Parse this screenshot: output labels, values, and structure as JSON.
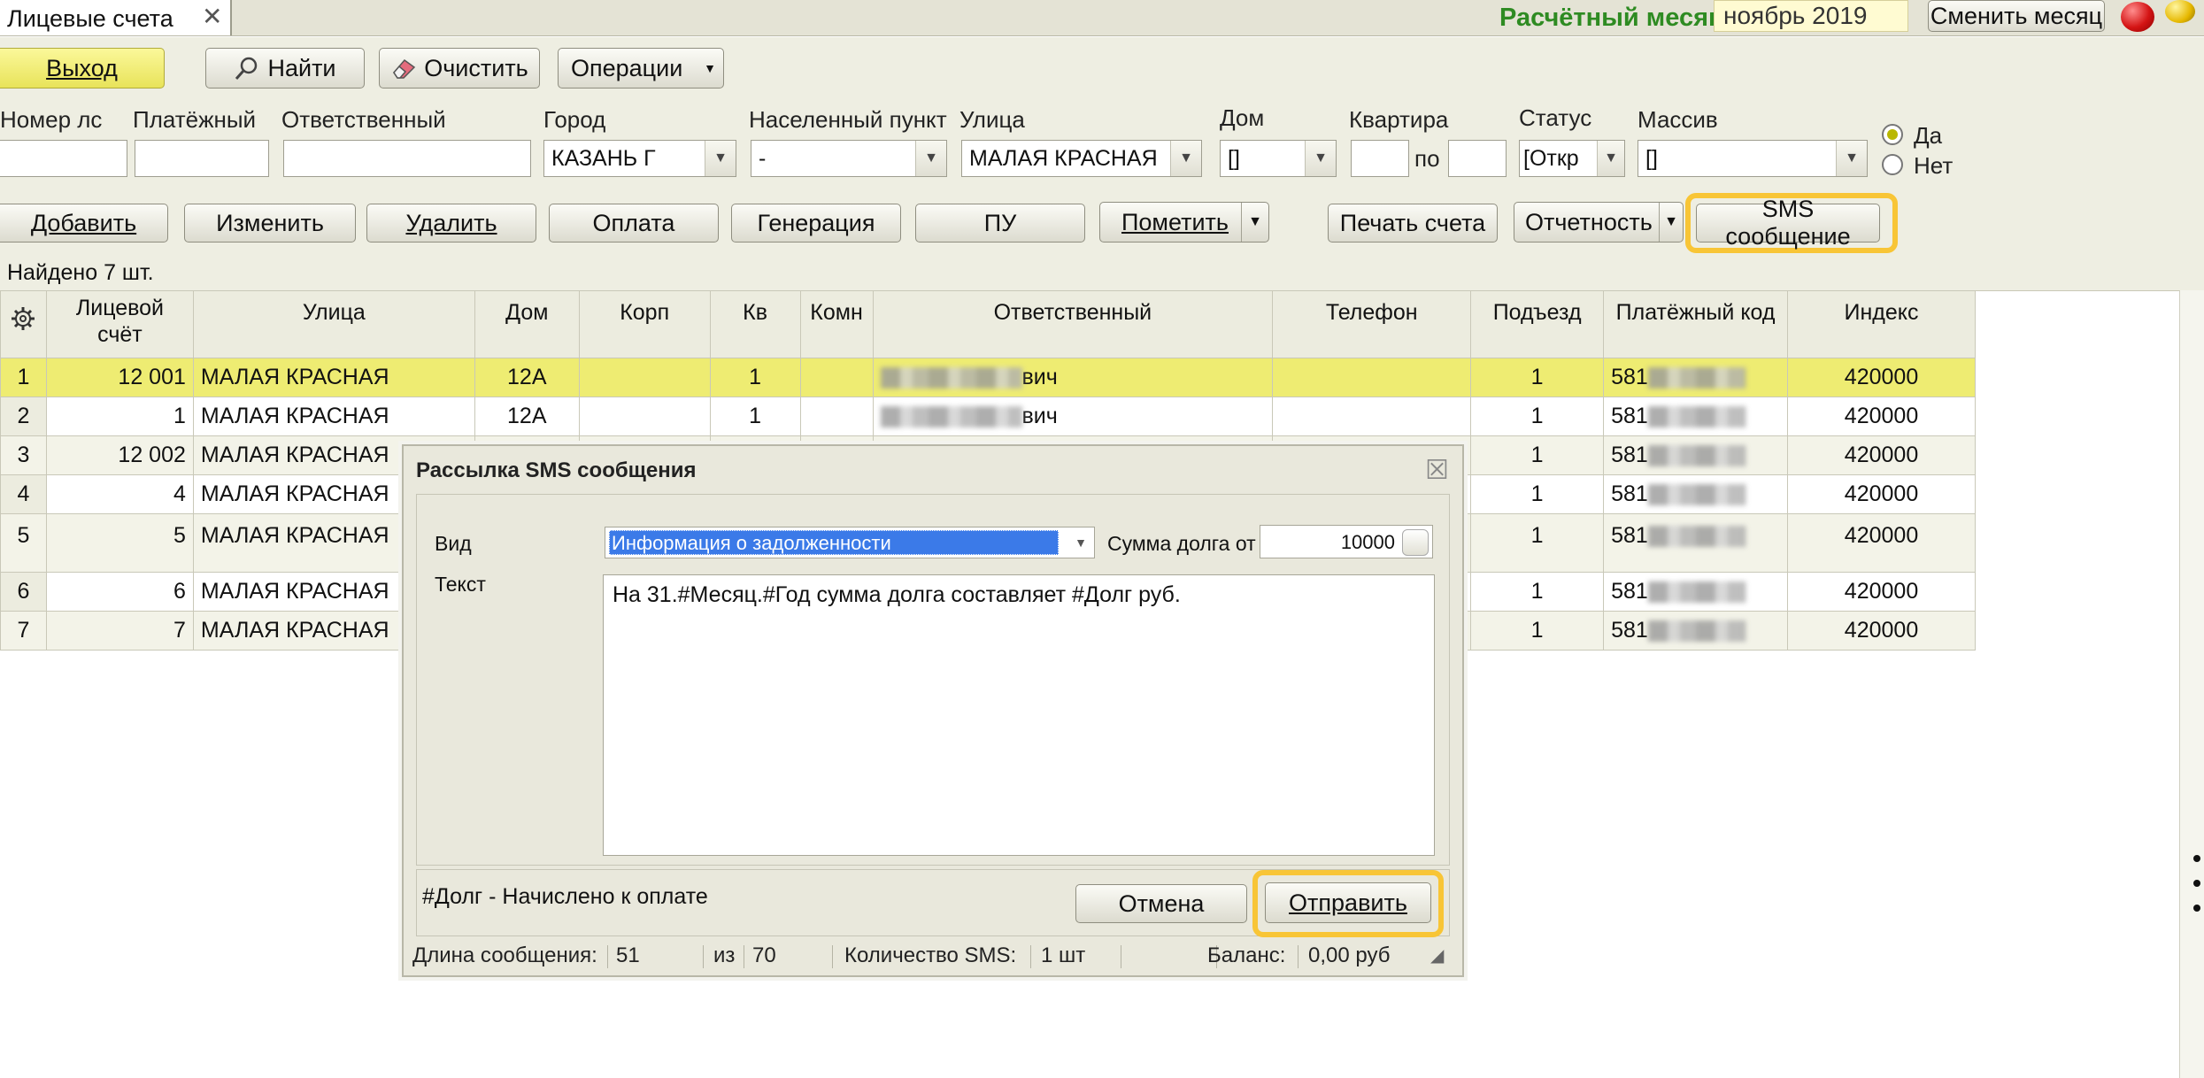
{
  "titlebar": {
    "tab_title": "Лицевые счета",
    "tab_close": "✕",
    "month_label": "Расчётный месяц",
    "month_value": "ноябрь 2019",
    "change_month": "Сменить месяц"
  },
  "toolbar": {
    "exit": "Выход",
    "find": "Найти",
    "clear": "Очистить",
    "operations": "Операции"
  },
  "filters": {
    "account_no": {
      "label": "Номер лс",
      "value": ""
    },
    "payer": {
      "label": "Платёжный",
      "value": ""
    },
    "responsible": {
      "label": "Ответственный",
      "value": ""
    },
    "city": {
      "label": "Город",
      "value": "КАЗАНЬ Г"
    },
    "settlement": {
      "label": "Населенный пункт",
      "value": "-"
    },
    "street": {
      "label": "Улица",
      "value": "МАЛАЯ КРАСНАЯ"
    },
    "house": {
      "label": "Дом",
      "value": "[]"
    },
    "apartment": {
      "label": "Квартира",
      "value": "",
      "to_label": "по",
      "to_value": ""
    },
    "status": {
      "label": "Статус",
      "value": "[Откр"
    },
    "array": {
      "label": "Массив",
      "value": "[]"
    },
    "radio_yes": "Да",
    "radio_no": "Нет",
    "radio_selected": "Да"
  },
  "actions": {
    "add": "Добавить",
    "edit": "Изменить",
    "delete": "Удалить",
    "payment": "Оплата",
    "generation": "Генерация",
    "pu": "ПУ",
    "mark": "Пометить",
    "print": "Печать счета",
    "reports": "Отчетность",
    "sms": "SMS сообщение",
    "highlight_color": "#f8c536"
  },
  "found_text": "Найдено 7 шт.",
  "grid": {
    "columns": [
      "Лицевой\nсчёт",
      "Улица",
      "Дом",
      "Корп",
      "Кв",
      "Комн",
      "Ответственный",
      "Телефон",
      "Подъезд",
      "Платёжный код",
      "Индекс"
    ],
    "rows": [
      {
        "n": "1",
        "account": "12 001",
        "street": "МАЛАЯ КРАСНАЯ",
        "house": "12А",
        "korp": "",
        "kv": "1",
        "komn": "",
        "resp_tail": "вич",
        "phone": "",
        "entrance": "1",
        "pay_prefix": "581",
        "index": "420000",
        "selected": true
      },
      {
        "n": "2",
        "account": "1",
        "street": "МАЛАЯ КРАСНАЯ",
        "house": "12А",
        "korp": "",
        "kv": "1",
        "komn": "",
        "resp_tail": "вич",
        "phone": "",
        "entrance": "1",
        "pay_prefix": "581",
        "index": "420000"
      },
      {
        "n": "3",
        "account": "12 002",
        "street": "МАЛАЯ КРАСНАЯ",
        "house": "",
        "korp": "",
        "kv": "",
        "komn": "",
        "resp_tail": "",
        "phone": "",
        "entrance": "1",
        "pay_prefix": "581",
        "index": "420000"
      },
      {
        "n": "4",
        "account": "4",
        "street": "МАЛАЯ КРАСНАЯ",
        "house": "",
        "korp": "",
        "kv": "",
        "komn": "",
        "resp_tail": "",
        "phone": "",
        "entrance": "1",
        "pay_prefix": "581",
        "index": "420000"
      },
      {
        "n": "5",
        "account": "5",
        "street": "МАЛАЯ КРАСНАЯ",
        "house": "",
        "korp": "",
        "kv": "",
        "komn": "",
        "resp_tail": "",
        "phone": "",
        "entrance": "1",
        "pay_prefix": "581",
        "index": "420000",
        "tall": true
      },
      {
        "n": "6",
        "account": "6",
        "street": "МАЛАЯ КРАСНАЯ",
        "house": "",
        "korp": "",
        "kv": "",
        "komn": "",
        "resp_tail": "",
        "phone": "",
        "entrance": "1",
        "pay_prefix": "581",
        "index": "420000"
      },
      {
        "n": "7",
        "account": "7",
        "street": "МАЛАЯ КРАСНАЯ",
        "house": "",
        "korp": "",
        "kv": "",
        "komn": "",
        "resp_tail": "",
        "phone": "",
        "entrance": "1",
        "pay_prefix": "581",
        "index": "420000"
      }
    ]
  },
  "dialog": {
    "title": "Рассылка SMS сообщения",
    "close": "☒",
    "type_label": "Вид",
    "type_value": "Информация о задолженности",
    "debt_label": "Сумма долга от",
    "debt_value": "10000",
    "text_label": "Текст",
    "text_value": "На 31.#Месяц.#Год сумма долга составляет #Долг руб.",
    "hint": "#Долг - Начислено к оплате",
    "cancel": "Отмена",
    "send": "Отправить",
    "status": {
      "length_label": "Длина сообщения:",
      "length_value": "51",
      "of_label": "из",
      "of_value": "70",
      "count_label": "Количество SMS:",
      "count_value": "1 шт",
      "balance_label": "Баланс:",
      "balance_value": "0,00 руб"
    },
    "select_color": "#3b7ae8"
  }
}
